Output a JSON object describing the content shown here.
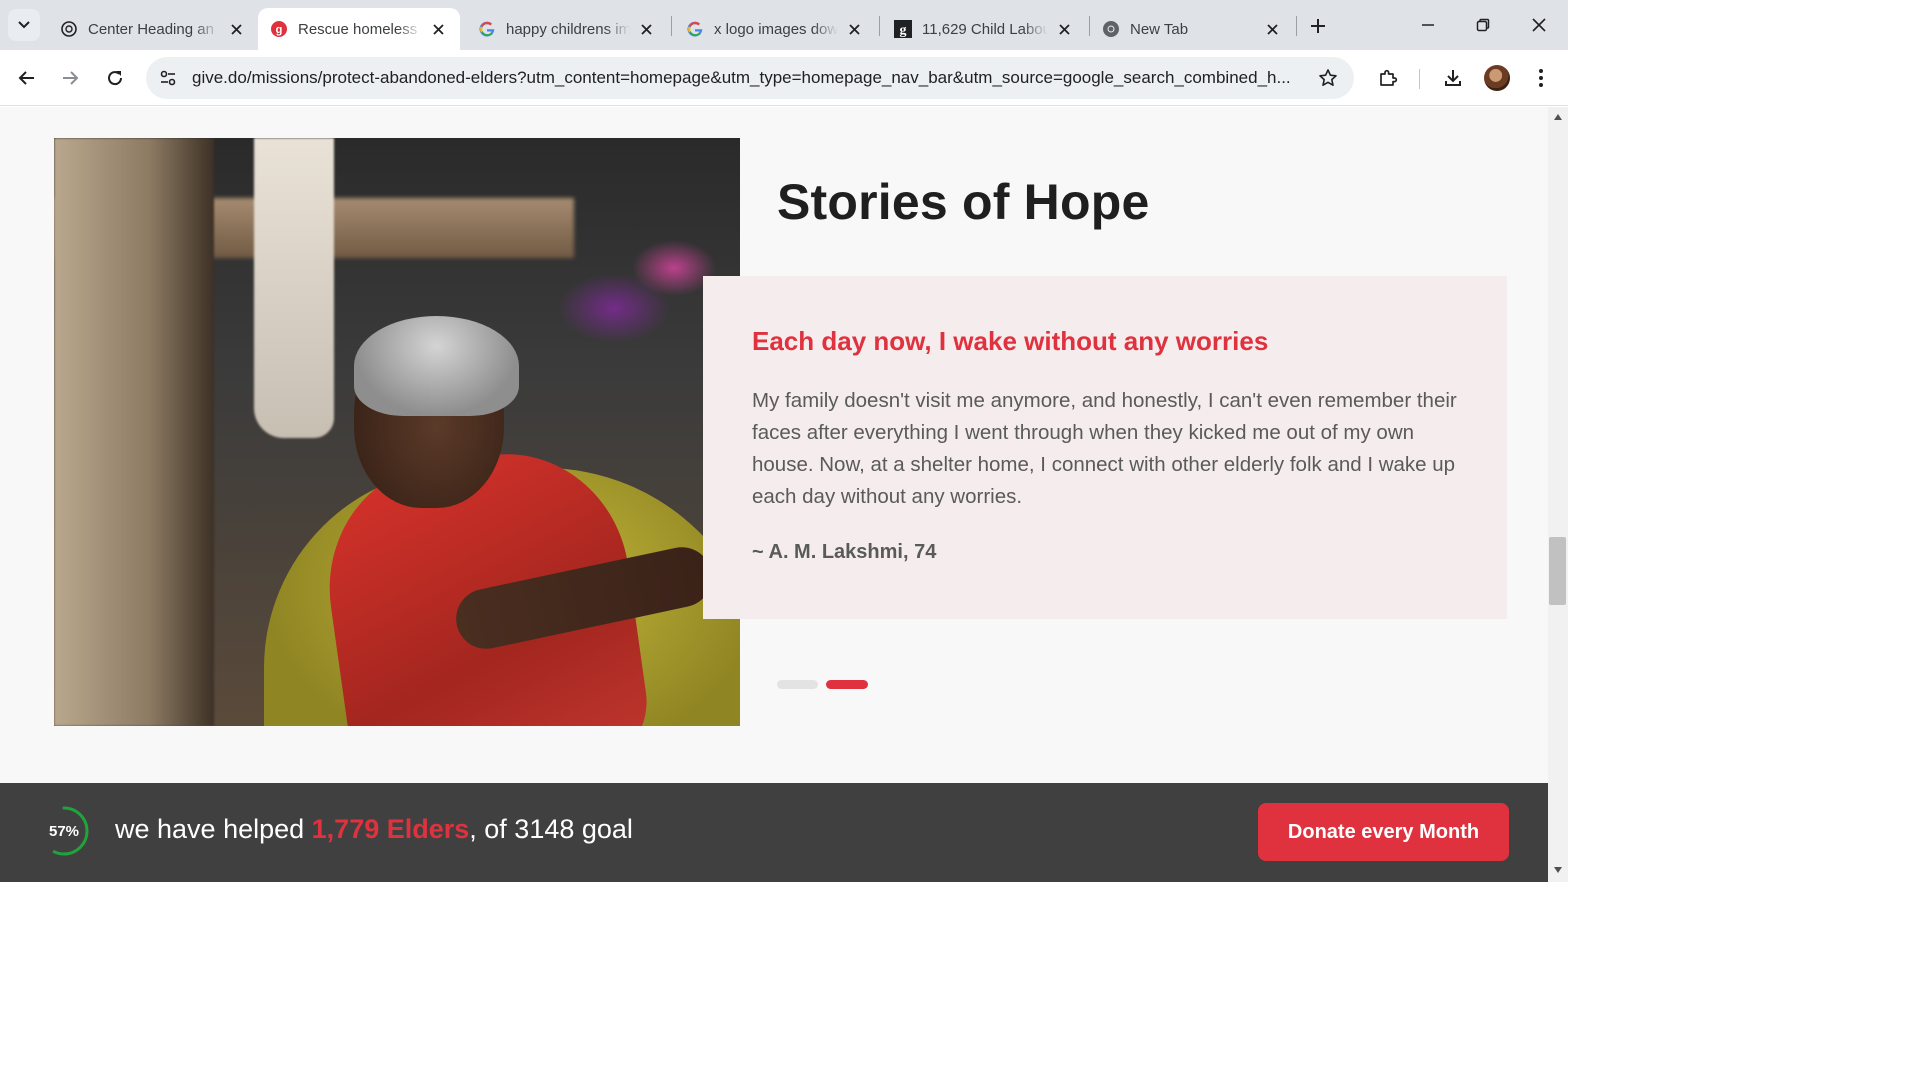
{
  "browser": {
    "tabs": [
      {
        "title": "Center Heading an",
        "icon": "chatgpt-icon",
        "active": false
      },
      {
        "title": "Rescue homeless s",
        "icon": "give-logo-icon",
        "active": true
      },
      {
        "title": "happy childrens im",
        "icon": "google-icon",
        "active": false
      },
      {
        "title": "x logo images dow",
        "icon": "google-icon",
        "active": false
      },
      {
        "title": "11,629 Child Labou",
        "icon": "getty-icon",
        "active": false
      },
      {
        "title": "New Tab",
        "icon": "chrome-icon",
        "active": false
      }
    ],
    "url": "give.do/missions/protect-abandoned-elders?utm_content=homepage&utm_type=homepage_nav_bar&utm_source=google_search_combined_h..."
  },
  "stories": {
    "title": "Stories of Hope",
    "quote_heading": "Each day now, I wake without any worries",
    "quote_text": "My family doesn't visit me anymore, and honestly, I can't even remember their faces after everything I went through when they kicked me out of my own house. Now, at a shelter home, I connect with other elderly folk and I wake up each day without any worries.",
    "author": "~ A. M. Lakshmi, 74",
    "carousel_active_index": 1,
    "carousel_count": 2
  },
  "donate_bar": {
    "progress_percent": 57,
    "progress_label": "57%",
    "text_before": "we have helped ",
    "count_text": "1,779 Elders",
    "text_after": ", of 3148 goal",
    "button_label": "Donate every Month"
  },
  "colors": {
    "accent": "#e0323e",
    "bar_background": "#404040",
    "card_background": "#f5eded",
    "progress_ring": "#1fa33a"
  }
}
